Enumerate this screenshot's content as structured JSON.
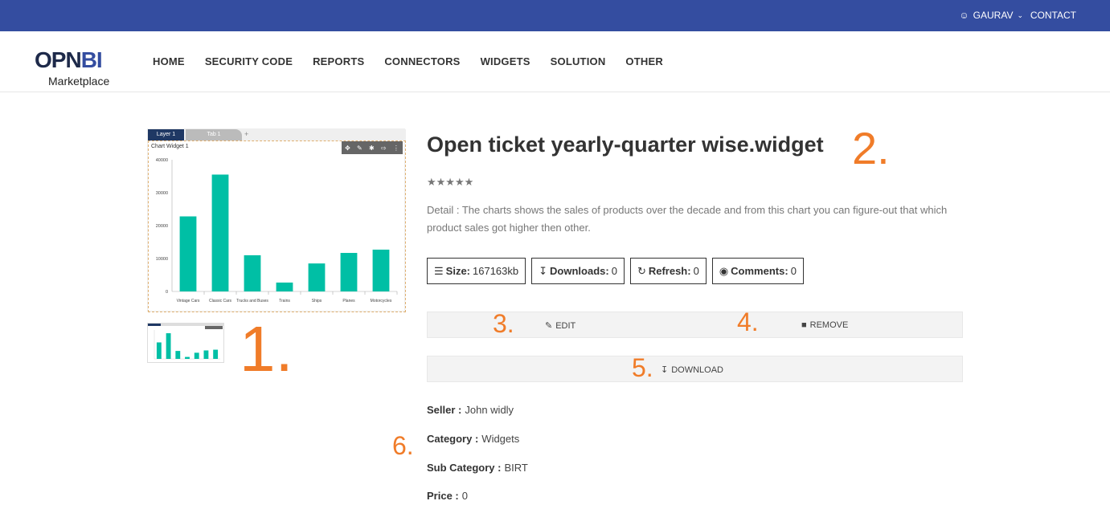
{
  "topbar": {
    "user": "GAURAV",
    "contact": "CONTACT"
  },
  "logo": {
    "brand_a": "OPN",
    "brand_b": "BI",
    "sub": "Marketplace"
  },
  "menu": [
    "HOME",
    "SECURITY CODE",
    "REPORTS",
    "CONNECTORS",
    "WIDGETS",
    "SOLUTION",
    "OTHER"
  ],
  "preview": {
    "tab_layer": "Layer 1",
    "tab_tab": "Tab 1",
    "tab_plus": "+",
    "chart_title": "Chart Widget 1"
  },
  "chart_data": {
    "type": "bar",
    "title": "Chart Widget 1",
    "categories": [
      "Vintage Cars",
      "Classic Cars",
      "Trucks and Buses",
      "Trains",
      "Ships",
      "Planes",
      "Motorcycles"
    ],
    "values": [
      22800,
      35500,
      11000,
      2700,
      8500,
      11700,
      12700
    ],
    "ylim": [
      0,
      40000
    ],
    "yticks": [
      "0",
      "10000",
      "20000",
      "30000",
      "40000"
    ],
    "color": "#00bfa5"
  },
  "product": {
    "title": "Open ticket yearly-quarter wise.widget",
    "rating": "★★★★★",
    "detail": "Detail : The charts shows the sales of products over the decade and from this chart you can figure-out that which product sales got higher then other."
  },
  "stats": {
    "size_label": "Size:",
    "size_value": "167163kb",
    "downloads_label": "Downloads:",
    "downloads_value": "0",
    "refresh_label": "Refresh:",
    "refresh_value": "0",
    "comments_label": "Comments:",
    "comments_value": "0"
  },
  "actions": {
    "edit": "EDIT",
    "remove": "REMOVE",
    "download": "DOWNLOAD"
  },
  "annotations": {
    "n1": "1.",
    "n2": "2.",
    "n3": "3.",
    "n4": "4.",
    "n5": "5.",
    "n6": "6."
  },
  "info": {
    "seller_label": "Seller :",
    "seller_value": "John widly",
    "category_label": "Category :",
    "category_value": "Widgets",
    "subcategory_label": "Sub Category :",
    "subcategory_value": "BIRT",
    "price_label": "Price :",
    "price_value": "0"
  }
}
